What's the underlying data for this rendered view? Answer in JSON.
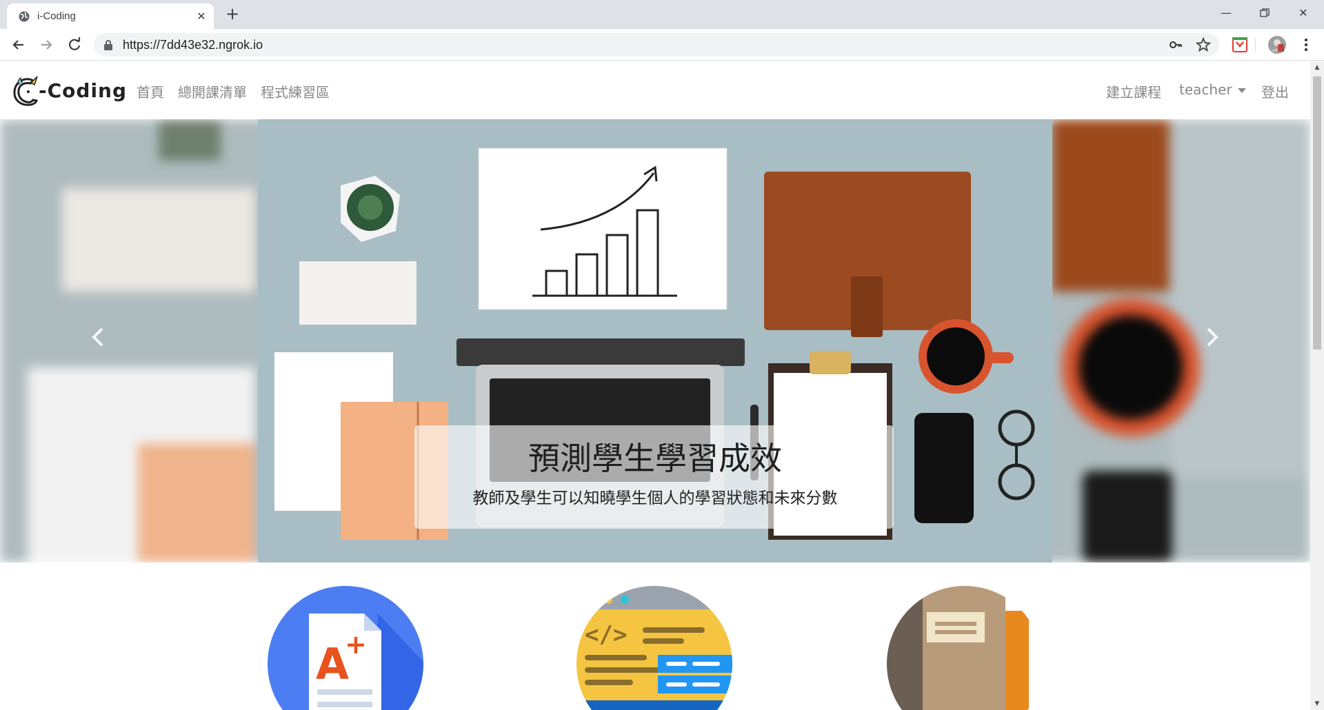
{
  "browser": {
    "tab_title": "i-Coding",
    "url": "https://7dd43e32.ngrok.io"
  },
  "navbar": {
    "brand": "-Coding",
    "links": [
      "首頁",
      "總開課清單",
      "程式練習區"
    ],
    "right_links": {
      "create_course": "建立課程",
      "user": "teacher",
      "logout": "登出"
    }
  },
  "carousel": {
    "caption_title": "預測學生學習成效",
    "caption_text": "教師及學生可以知曉學生個人的學習狀態和未來分數"
  },
  "features": [
    {
      "icon": "grade-document-icon"
    },
    {
      "icon": "code-window-icon"
    },
    {
      "icon": "notebook-icon"
    }
  ],
  "colors": {
    "accent_blue": "#4c7df2",
    "accent_yellow": "#f5c542",
    "accent_brown": "#b89b7a"
  }
}
